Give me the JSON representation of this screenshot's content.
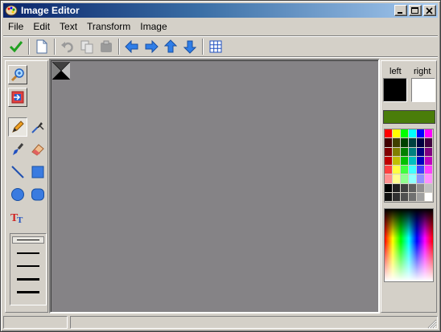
{
  "window": {
    "title": "Image Editor"
  },
  "menu": {
    "items": [
      "File",
      "Edit",
      "Text",
      "Transform",
      "Image"
    ]
  },
  "toolbar": {
    "buttons": [
      "check-icon",
      "new-page-icon",
      "undo-icon",
      "copy-icon",
      "paste-icon",
      "arrow-left-icon",
      "arrow-right-icon",
      "arrow-up-icon",
      "arrow-down-icon",
      "grid-icon"
    ]
  },
  "tools": {
    "items": [
      "zoom-icon",
      "resize-icon",
      "pencil-icon",
      "color-picker-icon",
      "brush-icon",
      "eraser-icon",
      "line-icon",
      "rectangle-icon",
      "ellipse-icon",
      "rounded-rectangle-icon",
      "text-tool-icon"
    ],
    "selected": "pencil",
    "line_widths": [
      1,
      2,
      3,
      4,
      5
    ],
    "selected_line_width": 1
  },
  "colors": {
    "left_label": "left",
    "right_label": "right",
    "left_color": "#000000",
    "right_color": "#ffffff",
    "current_color": "#4a7d0a",
    "palette": [
      "#ff0000",
      "#ffff00",
      "#00ff00",
      "#00ffff",
      "#0000ff",
      "#ff00ff",
      "#400000",
      "#404000",
      "#004000",
      "#004040",
      "#000040",
      "#400040",
      "#800000",
      "#808000",
      "#008000",
      "#008080",
      "#000080",
      "#800080",
      "#c00000",
      "#c0c000",
      "#00c000",
      "#00c0c0",
      "#0000c0",
      "#c000c0",
      "#ff4040",
      "#ffff40",
      "#40ff40",
      "#40ffff",
      "#4040ff",
      "#ff40ff",
      "#ff9090",
      "#ffff90",
      "#90ff90",
      "#90ffff",
      "#9090ff",
      "#ff90ff",
      "#000000",
      "#202020",
      "#404040",
      "#606060",
      "#909090",
      "#c0c0c0",
      "#101010",
      "#303030",
      "#505050",
      "#707070",
      "#a0a0a0",
      "#ffffff"
    ]
  }
}
